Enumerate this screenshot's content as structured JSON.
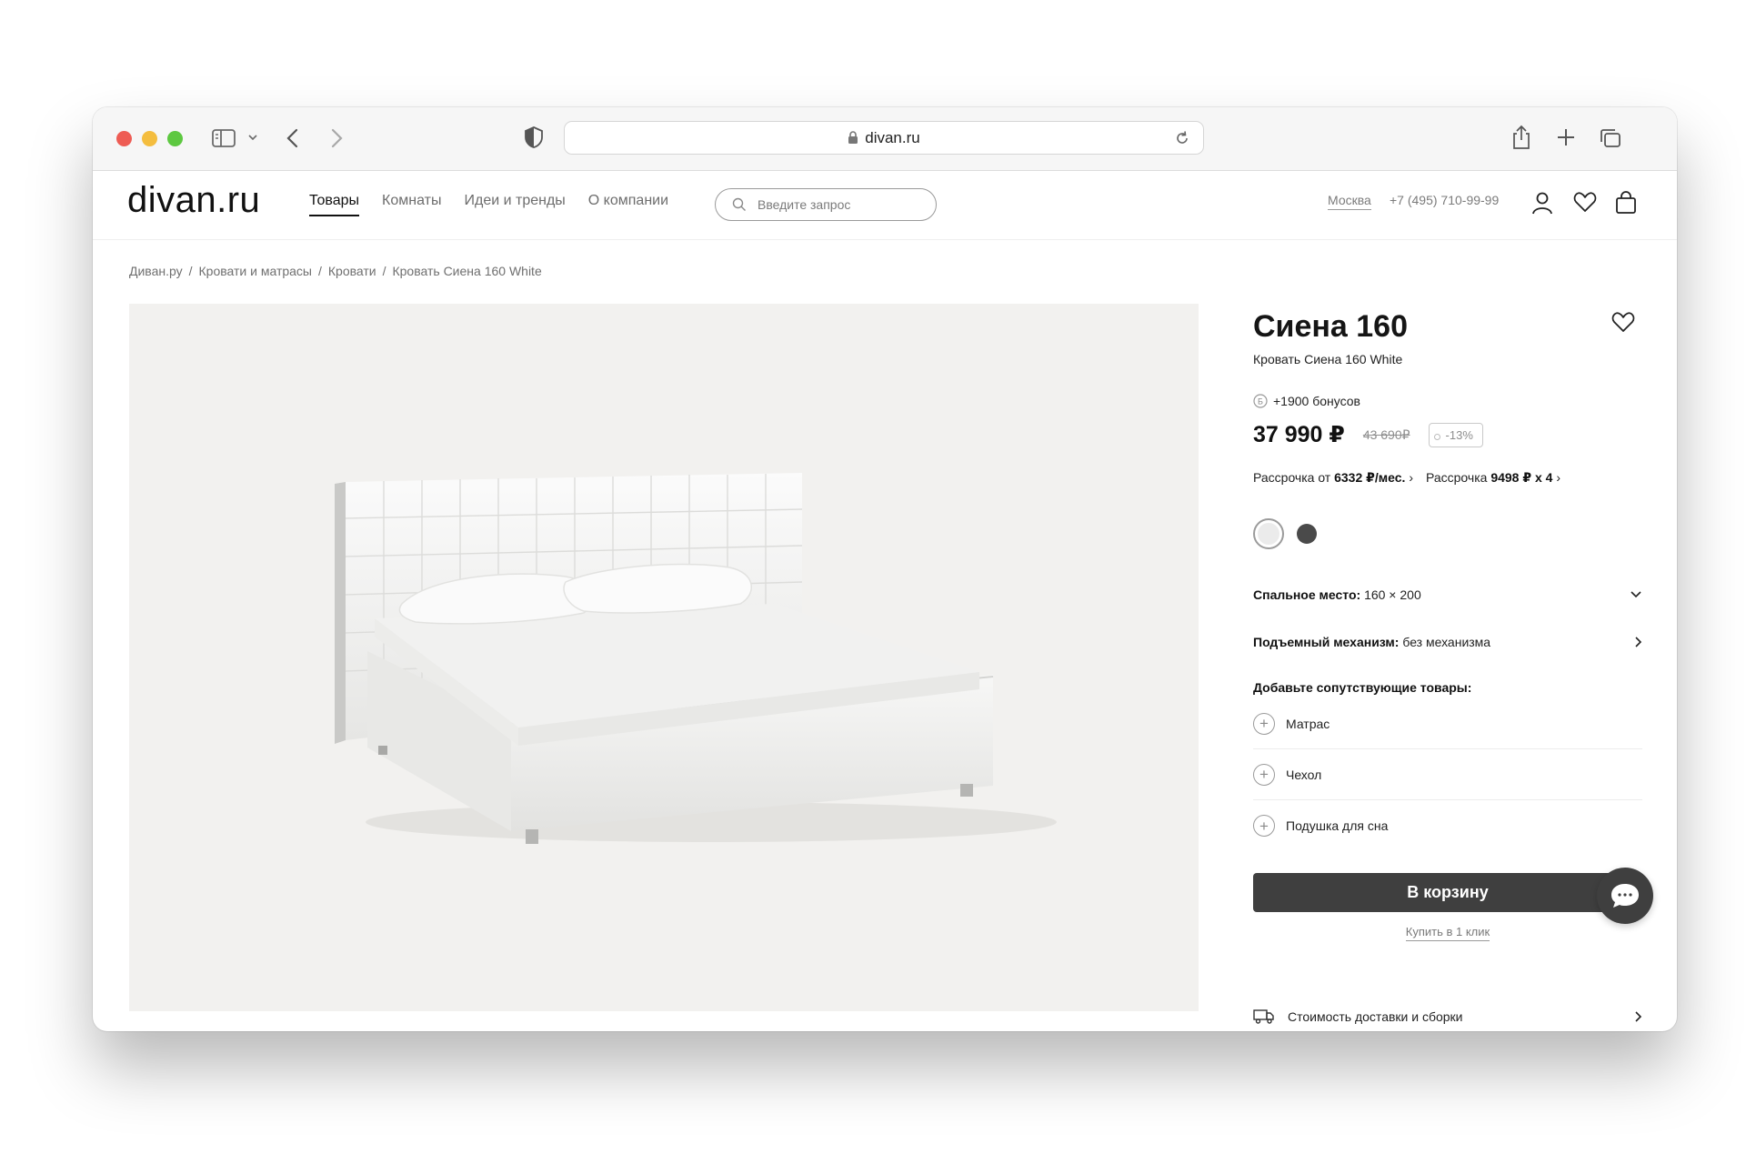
{
  "browser": {
    "url": "divan.ru",
    "colors": {
      "close": "#ee5c54",
      "minimize": "#f4bd3e",
      "zoom": "#5dc840"
    }
  },
  "header": {
    "logo": "divan.ru",
    "nav": [
      "Товары",
      "Комнаты",
      "Идеи и тренды",
      "О компании"
    ],
    "search_placeholder": "Введите запрос",
    "city": "Москва",
    "phone": "+7 (495) 710-99-99"
  },
  "breadcrumb": [
    "Диван.ру",
    "/",
    "Кровати и матрасы",
    "/",
    "Кровати",
    "/",
    "Кровать Сиена 160 White"
  ],
  "product": {
    "title": "Сиена 160",
    "subtitle": "Кровать Сиена 160 White",
    "bonus": "+1900 бонусов",
    "price": "37 990 ₽",
    "old_price": "43 690₽",
    "discount": "-13%",
    "installment_1_label": "Рассрочка от",
    "installment_1_value": "6332 ₽/мес.",
    "installment_2_label": "Рассрочка",
    "installment_2_value": "9498 ₽ x 4",
    "sleep_place_label": "Спальное место:",
    "sleep_place_value": "160 × 200",
    "mechanism_label": "Подъемный механизм:",
    "mechanism_value": "без механизма",
    "addons_title": "Добавьте сопутствующие товары:",
    "addons": [
      "Матрас",
      "Чехол",
      "Подушка для сна"
    ],
    "cart_button": "В корзину",
    "one_click": "Купить в 1 клик",
    "delivery": "Стоимость доставки и сборки",
    "colors": [
      "#ebebeb",
      "#4a4a4a"
    ]
  }
}
